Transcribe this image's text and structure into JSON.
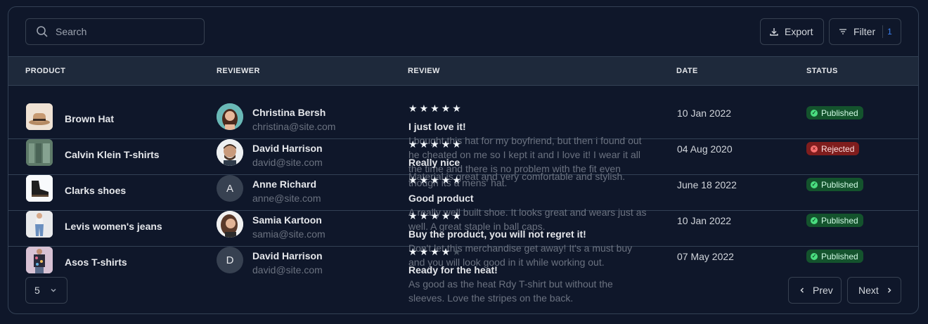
{
  "toolbar": {
    "search_placeholder": "Search",
    "export_label": "Export",
    "filter_label": "Filter",
    "filter_count": "1"
  },
  "columns": {
    "product": "PRODUCT",
    "reviewer": "REVIEWER",
    "review": "REVIEW",
    "date": "DATE",
    "status": "STATUS"
  },
  "rows": [
    {
      "product": "Brown Hat",
      "reviewer_name": "Christina Bersh",
      "reviewer_email": "christina@site.com",
      "reviewer_initial": "",
      "rating": 5,
      "review_title": "I just love it!",
      "review_text": "I bought this hat for my boyfriend, but then i found out he cheated on me so I kept it and I love it! I wear it all the time and there is no problem with the fit even though its a mens' hat.",
      "date": "10 Jan 2022",
      "status": "Published",
      "status_icon": "check-icon"
    },
    {
      "product": "Calvin Klein T-shirts",
      "reviewer_name": "David Harrison",
      "reviewer_email": "david@site.com",
      "reviewer_initial": "",
      "rating": 5,
      "review_title": "Really nice",
      "review_text": "Material is great and very comfortable and stylish.",
      "date": "04 Aug 2020",
      "status": "Rejected",
      "status_icon": "x-icon"
    },
    {
      "product": "Clarks shoes",
      "reviewer_name": "Anne Richard",
      "reviewer_email": "anne@site.com",
      "reviewer_initial": "A",
      "rating": 5,
      "review_title": "Good product",
      "review_text": "A really well built shoe. It looks great and wears just as well. A great staple in ball caps.",
      "date": "June 18 2022",
      "status": "Published",
      "status_icon": "check-icon"
    },
    {
      "product": "Levis women's jeans",
      "reviewer_name": "Samia Kartoon",
      "reviewer_email": "samia@site.com",
      "reviewer_initial": "",
      "rating": 5,
      "review_title": "Buy the product, you will not regret it!",
      "review_text": "Don't let this merchandise get away! It's a must buy and you will look good in it while working out.",
      "date": "10 Jan 2022",
      "status": "Published",
      "status_icon": "check-icon"
    },
    {
      "product": "Asos T-shirts",
      "reviewer_name": "David Harrison",
      "reviewer_email": "david@site.com",
      "reviewer_initial": "D",
      "rating": 4,
      "review_title": "Ready for the heat!",
      "review_text": "As good as the heat Rdy T-shirt but without the sleeves. Love the stripes on the back.",
      "date": "07 May 2022",
      "status": "Published",
      "status_icon": "check-icon"
    }
  ],
  "pagination": {
    "page_size": "5",
    "prev_label": "Prev",
    "next_label": "Next"
  },
  "colors": {
    "background": "#0f172a",
    "header_bg": "#1e293b",
    "published_bg": "#14532d",
    "rejected_bg": "#7f1d1d",
    "accent": "#3b82f6"
  }
}
